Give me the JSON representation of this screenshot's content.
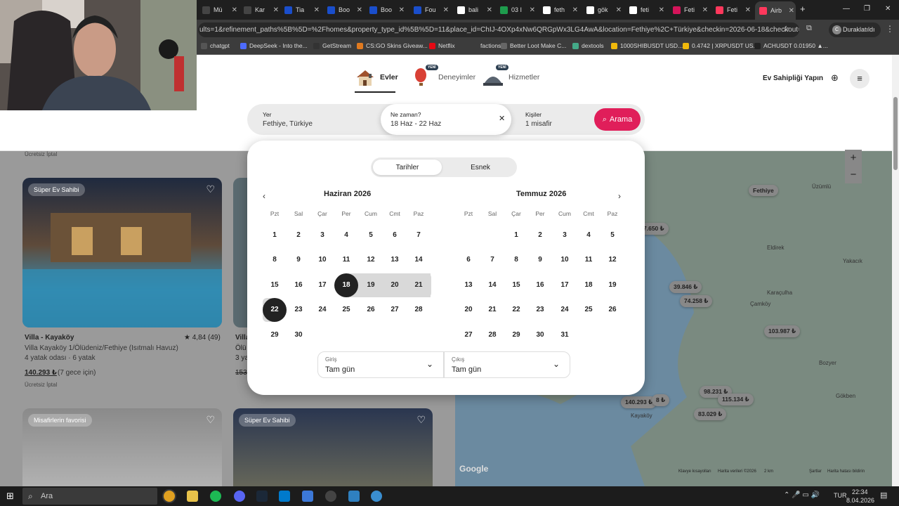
{
  "browser": {
    "tabs": [
      {
        "label": "Mü",
        "color": "#444"
      },
      {
        "label": "Kar",
        "color": "#444"
      },
      {
        "label": "Tia",
        "color": "#1a4ecb"
      },
      {
        "label": "Boo",
        "color": "#1a4ecb"
      },
      {
        "label": "Boo",
        "color": "#1a4ecb"
      },
      {
        "label": "Fou",
        "color": "#1a4ecb"
      },
      {
        "label": "bali",
        "color": "#fff"
      },
      {
        "label": "03 I",
        "color": "#1e9c4d"
      },
      {
        "label": "feth",
        "color": "#fff"
      },
      {
        "label": "gök",
        "color": "#fff"
      },
      {
        "label": "feti",
        "color": "#fff"
      },
      {
        "label": "Feti",
        "color": "#d4145a"
      },
      {
        "label": "Feti",
        "color": "#ff385c"
      },
      {
        "label": "Airb",
        "color": "#ff385c"
      }
    ],
    "url": "ults=1&refinement_paths%5B%5D=%2Fhomes&property_type_id%5B%5D=11&place_id=ChIJ-4OXp4xNw6QRGpWx3LG4AwA&location=Fethiye%2C+Türkiye&checkin=2026-06-18&checkout=2026...",
    "profile_label": "Duraklatıldı",
    "bookmarks": [
      "chatgpt",
      "DeepSeek - Into the...",
      "GetStream",
      "CS:GO Skins Giveaw...",
      "Netflix",
      "factions",
      "Better Loot Make C...",
      "dextools",
      "1000SHIBUSDT USD...",
      "0.4742 | XRPUSDT US...",
      "ACHUSDT 0.01950 ▲..."
    ]
  },
  "header": {
    "nav": [
      {
        "label": "Evler",
        "new": ""
      },
      {
        "label": "Deneyimler",
        "new": "YENİ"
      },
      {
        "label": "Hizmetler",
        "new": "YENİ"
      }
    ],
    "host_label": "Ev Sahipliği Yapın"
  },
  "search": {
    "where_label": "Yer",
    "where_value": "Fethiye, Türkiye",
    "when_label": "Ne zaman?",
    "when_value": "18 Haz - 22 Haz",
    "who_label": "Kişiler",
    "who_value": "1 misafir",
    "button_label": "Arama"
  },
  "calendar": {
    "tabs": [
      "Tarihler",
      "Esnek"
    ],
    "dow": [
      "Pzt",
      "Sal",
      "Çar",
      "Per",
      "Cum",
      "Cmt",
      "Paz"
    ],
    "months": [
      {
        "title": "Haziran 2026",
        "offset": 0,
        "days": 30
      },
      {
        "title": "Temmuz 2026",
        "offset": 2,
        "days": 31
      }
    ],
    "checkin_label": "Giriş",
    "checkin_value": "Tam gün",
    "checkout_label": "Çıkış",
    "checkout_value": "Tam gün"
  },
  "listings": [
    {
      "badge": "Süper Ev Sahibi",
      "title": "Villa - Kayaköy",
      "rating": "★ 4,84 (49)",
      "sub": "Villa Kayaköy 1/Ölüdeniz/Fethiye (Isıtmalı Havuz)",
      "rooms": "4 yatak odası · 6 yatak",
      "price": "140.293 ₺",
      "price_note": "(7 gece için)",
      "cancel": "Ücretsiz İptal"
    },
    {
      "badge": "",
      "title": "Villa",
      "sub": "Ölü",
      "rooms": "3 ya",
      "price": "153."
    }
  ],
  "top_cancel": "Ücretsiz İptal",
  "bottom_cards": [
    {
      "badge": "Misafirlerin favorisi"
    },
    {
      "badge": "Süper Ev Sahibi"
    }
  ],
  "map": {
    "place_labels": [
      "Fethiye",
      "Üzümlü",
      "Yakacık",
      "Eldirek",
      "Karaçulha",
      "Çamköy",
      "Bozyer",
      "Gökben",
      "Kayaköy"
    ],
    "prices": [
      "7.650 ₺",
      "39.846 ₺",
      "74.258 ₺",
      "103.987 ₺",
      "98.231 ₺",
      "115.134 ₺",
      "140.293 ₺",
      "83.029 ₺",
      "8 ₺"
    ],
    "google": "Google",
    "footer": [
      "Klavye kısayolları",
      "Harita verileri ©2026",
      "2 km",
      "Şartlar",
      "Harita hatası bildirin"
    ]
  },
  "taskbar": {
    "search_label": "Ara",
    "lang": "TUR",
    "time": "22:34",
    "date": "8.04.2026"
  }
}
